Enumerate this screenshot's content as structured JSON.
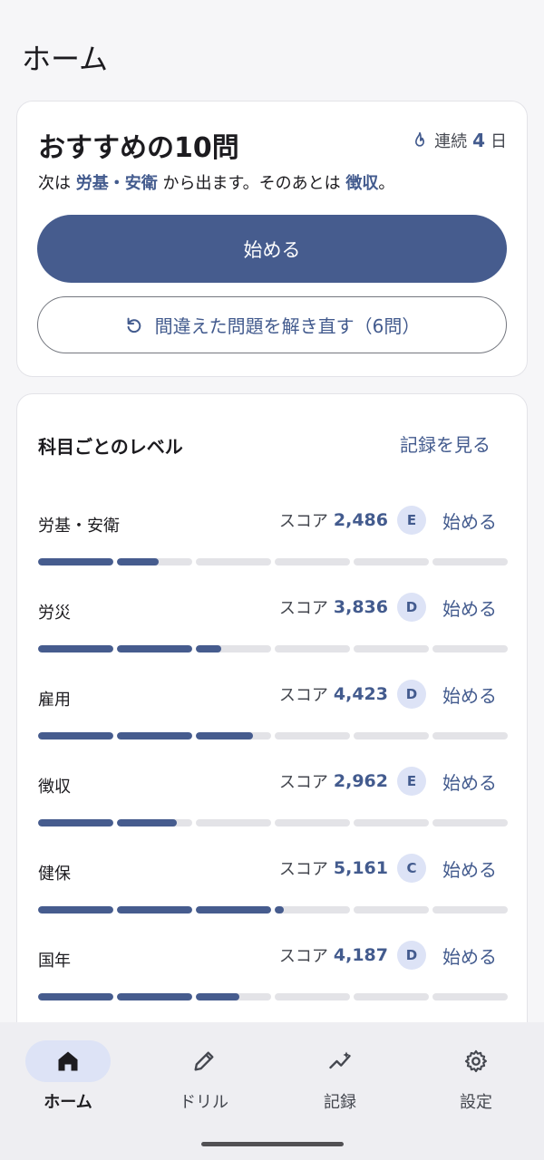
{
  "header": {
    "title": "ホーム"
  },
  "recommended": {
    "title": "おすすめの10問",
    "streak_label": "連続",
    "streak_count": "4",
    "streak_unit": "日",
    "subtitle_prefix": "次は",
    "next_subject": "労基・安衛",
    "subtitle_middle": "から出ます。そのあとは",
    "after_subject": "徴収",
    "subtitle_suffix": "。",
    "start_label": "始める",
    "retry_label": "間違えた問題を解き直す（6問）"
  },
  "levels": {
    "title": "科目ごとのレベル",
    "records_link": "記録を見る",
    "score_label": "スコア",
    "start_label": "始める",
    "subjects": [
      {
        "name": "労基・安衛",
        "score": "2,486",
        "grade": "E",
        "progress": 0.26
      },
      {
        "name": "労災",
        "score": "3,836",
        "grade": "D",
        "progress": 0.39
      },
      {
        "name": "雇用",
        "score": "4,423",
        "grade": "D",
        "progress": 0.46
      },
      {
        "name": "徴収",
        "score": "2,962",
        "grade": "E",
        "progress": 0.3
      },
      {
        "name": "健保",
        "score": "5,161",
        "grade": "C",
        "progress": 0.52
      },
      {
        "name": "国年",
        "score": "4,187",
        "grade": "D",
        "progress": 0.43
      }
    ]
  },
  "nav": {
    "items": [
      {
        "label": "ホーム",
        "icon": "home-icon",
        "active": true
      },
      {
        "label": "ドリル",
        "icon": "pencil-icon",
        "active": false
      },
      {
        "label": "記録",
        "icon": "chart-icon",
        "active": false
      },
      {
        "label": "設定",
        "icon": "gear-icon",
        "active": false
      }
    ]
  },
  "colors": {
    "primary": "#465c8e",
    "accent_text": "#435b8e",
    "grade_bg": "#dde3f6"
  }
}
